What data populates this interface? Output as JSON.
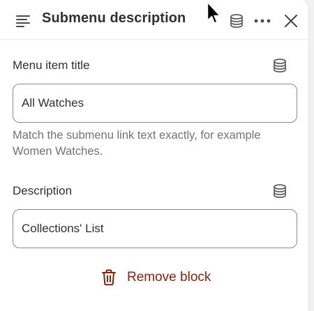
{
  "header": {
    "title": "Submenu description",
    "icons": {
      "menu": "text-align-left-icon",
      "database": "database-icon",
      "more": "more-horizontal-icon",
      "close": "close-icon"
    }
  },
  "fields": {
    "menu_item_title": {
      "label": "Menu item title",
      "value": "All Watches",
      "help": "Match the submenu link text exactly, for example Women Watches."
    },
    "description": {
      "label": "Description",
      "value": "Collections' List"
    }
  },
  "actions": {
    "remove_label": "Remove block",
    "remove_color": "#8e1f0b"
  }
}
